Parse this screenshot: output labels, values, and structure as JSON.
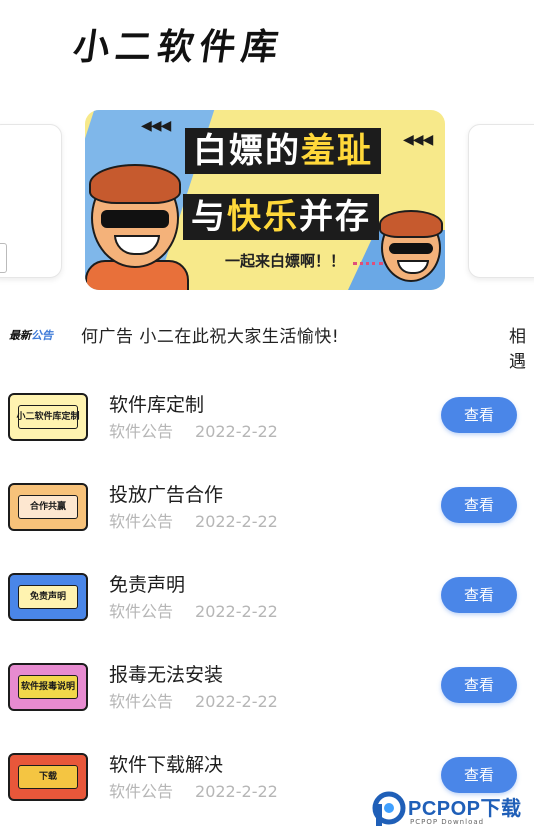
{
  "app": {
    "title": "小二软件库"
  },
  "banner": {
    "line1_a": "白嫖的",
    "line1_b": "羞耻",
    "line2_a": "与",
    "line2_b": "快乐",
    "line2_c": "并存",
    "subtitle": "一起来白嫖啊！！",
    "colors": {
      "yellow": "#f7e98a",
      "blue": "#7fb7ea",
      "dark": "#1c1c1c",
      "highlight": "#ffd83a"
    }
  },
  "notice": {
    "tag_a": "最新",
    "tag_b": "公告",
    "text": "何广告  小二在此祝大家生活愉快!",
    "text_right": "相遇"
  },
  "list": {
    "items": [
      {
        "title": "软件库定制",
        "category": "软件公告",
        "date": "2022-2-22",
        "button": "查看",
        "thumb_label": "小二软件库定制",
        "thumb_color": "#fff3b0"
      },
      {
        "title": "投放广告合作",
        "category": "软件公告",
        "date": "2022-2-22",
        "button": "查看",
        "thumb_label": "合作共赢",
        "thumb_color": "#f7c27a"
      },
      {
        "title": "免责声明",
        "category": "软件公告",
        "date": "2022-2-22",
        "button": "查看",
        "thumb_label": "免责声明",
        "thumb_color": "#4a86e8"
      },
      {
        "title": "报毒无法安装",
        "category": "软件公告",
        "date": "2022-2-22",
        "button": "查看",
        "thumb_label": "软件报毒说明",
        "thumb_color": "#f1d84a"
      },
      {
        "title": "软件下载解决",
        "category": "软件公告",
        "date": "2022-2-22",
        "button": "查看",
        "thumb_label": "下载",
        "thumb_color": "#e8573a"
      }
    ]
  },
  "watermark": {
    "name": "PCPOP下载",
    "sub": "PCPOP Download"
  },
  "colors": {
    "accent": "#4a86e8",
    "meta": "#b6b6b6"
  }
}
